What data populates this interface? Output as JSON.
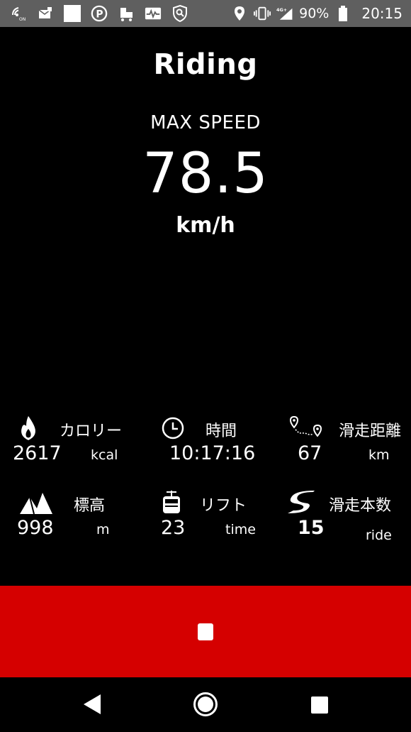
{
  "status_bar": {
    "icons": [
      "wifi-calling-icon",
      "mail-icon",
      "white-square-icon",
      "parking-icon",
      "luggage-icon",
      "activity-icon",
      "search-shield-icon"
    ],
    "right_icons": [
      "location-icon",
      "vibrate-icon",
      "signal-4g-icon",
      "battery-icon"
    ],
    "network": "4G+",
    "battery": "90%",
    "time": "20:15"
  },
  "header": {
    "title": "Riding",
    "max_label": "MAX SPEED",
    "max_value": "78.5",
    "max_unit": "km/h"
  },
  "stats": {
    "calories": {
      "icon": "flame-icon",
      "label": "カロリー",
      "value": "2617",
      "unit": "kcal"
    },
    "time": {
      "icon": "clock-icon",
      "label": "時間",
      "value": "10:17:16"
    },
    "distance": {
      "icon": "route-pins-icon",
      "label": "滑走距離",
      "value": "67",
      "unit": "km"
    },
    "altitude": {
      "icon": "mountain-icon",
      "label": "標高",
      "value": "998",
      "unit": "m"
    },
    "lift": {
      "icon": "gondola-icon",
      "label": "リフト",
      "value": "23",
      "unit": "time"
    },
    "runs": {
      "icon": "slope-s-icon",
      "label": "滑走本数",
      "value": "15",
      "unit": "ride"
    }
  },
  "controls": {
    "stop_color": "#d50000",
    "stop_icon": "stop-icon"
  },
  "nav_bar": {
    "back_icon": "back-triangle-icon",
    "home_icon": "home-circle-icon",
    "recent_icon": "recent-square-icon"
  }
}
